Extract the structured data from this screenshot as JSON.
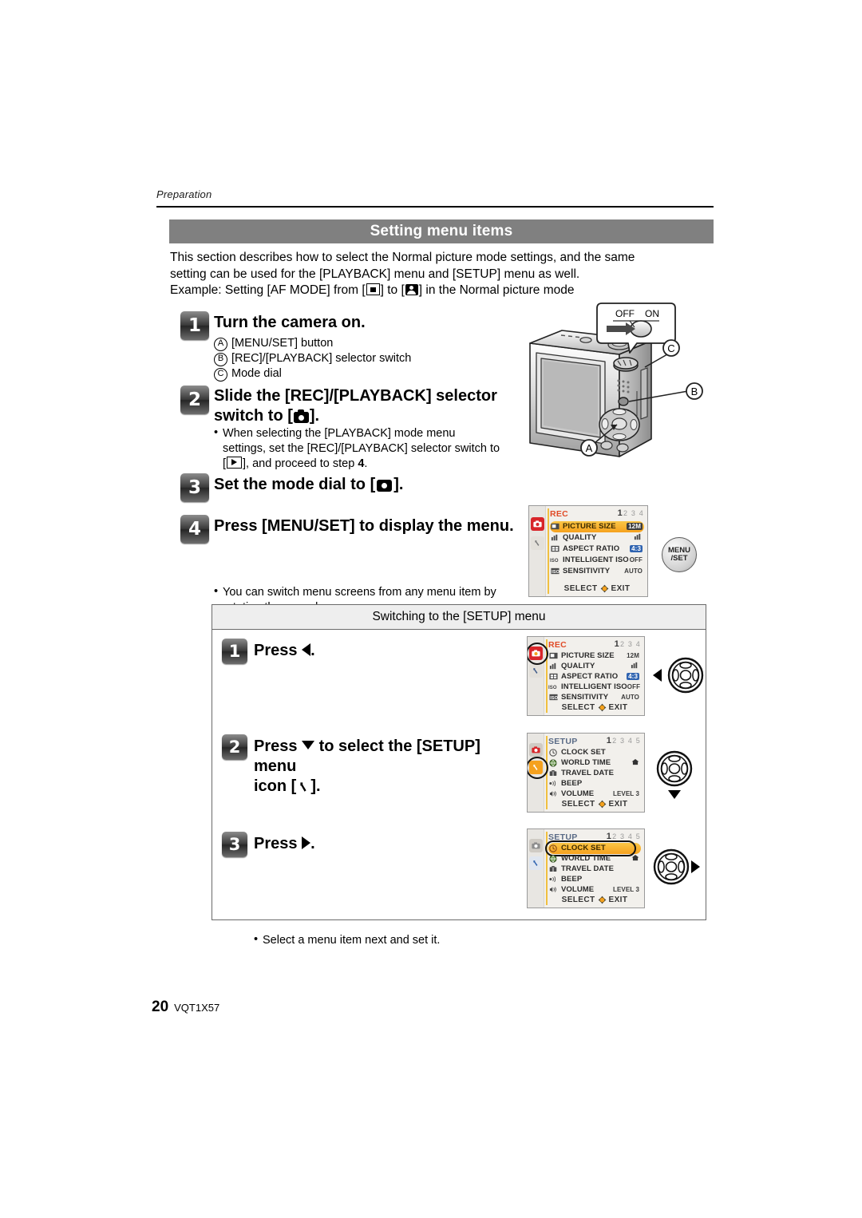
{
  "running_head": "Preparation",
  "section_title": "Setting menu items",
  "intro": {
    "line1": "This section describes how to select the Normal picture mode settings, and the same",
    "line2": "setting can be used for the [PLAYBACK] menu and [SETUP] menu as well.",
    "line3_prefix": "Example: Setting [AF MODE] from [",
    "line3_mid": "] to [",
    "line3_suffix": "] in the Normal picture mode"
  },
  "steps": [
    {
      "num": "1",
      "title": "Turn the camera on.",
      "callouts": [
        {
          "letter": "A",
          "text": "[MENU/SET] button"
        },
        {
          "letter": "B",
          "text": "[REC]/[PLAYBACK] selector switch"
        },
        {
          "letter": "C",
          "text": "Mode dial"
        }
      ]
    },
    {
      "num": "2",
      "title_line1": "Slide the [REC]/[PLAYBACK] selector",
      "title_line2_prefix": "switch to [",
      "title_line2_suffix": "].",
      "bullet_line1": "When selecting the [PLAYBACK] mode menu",
      "bullet_line2": "settings, set the [REC]/[PLAYBACK] selector switch to",
      "bullet_line3_prefix": "[",
      "bullet_line3_suffix": "], and proceed to step ",
      "bullet_line3_step": "4",
      "bullet_line3_end": "."
    },
    {
      "num": "3",
      "title_prefix": "Set the mode dial to [",
      "title_suffix": "]."
    },
    {
      "num": "4",
      "title": "Press [MENU/SET] to display the menu.",
      "bullet_line1": "You can switch menu screens from any menu item by",
      "bullet_line2": "rotating the zoom lever."
    }
  ],
  "camera": {
    "switch_off_label": "OFF",
    "switch_on_label": "ON",
    "label_a": "A",
    "label_b": "B",
    "label_c": "C"
  },
  "menuset_button": {
    "line1": "MENU",
    "line2": "/SET"
  },
  "switching_box": {
    "header": "Switching to the [SETUP] menu",
    "steps": [
      {
        "num": "1",
        "title_prefix": "Press ",
        "title_arrow": "left-arrow",
        "title_suffix": "."
      },
      {
        "num": "2",
        "title_line1_prefix": "Press ",
        "title_line1_arrow": "down-arrow",
        "title_line1_suffix": " to select the [SETUP] menu",
        "title_line2_prefix": "icon [",
        "title_line2_suffix": "]."
      },
      {
        "num": "3",
        "title_prefix": "Press ",
        "title_arrow": "right-arrow",
        "title_suffix": ".",
        "bullet": "Select a menu item next and set it."
      }
    ]
  },
  "lcd_screens": [
    {
      "id": "rec-menu-step4",
      "title": "REC",
      "pages": {
        "current": "1",
        "rest": "2 3 4"
      },
      "active_tab": "rec",
      "rows": [
        {
          "icon": "picture-size-icon",
          "label": "PICTURE SIZE",
          "value": "12M",
          "value_style": "box",
          "highlighted": true
        },
        {
          "icon": "quality-icon",
          "label": "QUALITY",
          "value": "",
          "value_style": "glyph",
          "highlighted": false
        },
        {
          "icon": "aspect-ratio-icon",
          "label": "ASPECT RATIO",
          "value": "4:3",
          "value_style": "blue",
          "highlighted": false
        },
        {
          "icon": "intelligent-iso-icon",
          "label": "INTELLIGENT ISO",
          "value": "OFF",
          "value_style": "plain",
          "highlighted": false
        },
        {
          "icon": "sensitivity-icon",
          "label": "SENSITIVITY",
          "value": "AUTO",
          "value_style": "plain",
          "highlighted": false
        }
      ],
      "footer": {
        "select": "SELECT",
        "exit": "EXIT"
      },
      "mark": "none"
    },
    {
      "id": "rec-menu-sub1",
      "title": "REC",
      "pages": {
        "current": "1",
        "rest": "2 3 4"
      },
      "active_tab": "rec",
      "rows": [
        {
          "icon": "picture-size-icon",
          "label": "PICTURE SIZE",
          "value": "12M",
          "value_style": "plain",
          "highlighted": false
        },
        {
          "icon": "quality-icon",
          "label": "QUALITY",
          "value": "",
          "value_style": "glyph",
          "highlighted": false
        },
        {
          "icon": "aspect-ratio-icon",
          "label": "ASPECT RATIO",
          "value": "4:3",
          "value_style": "blue",
          "highlighted": false
        },
        {
          "icon": "intelligent-iso-icon",
          "label": "INTELLIGENT ISO",
          "value": "OFF",
          "value_style": "plain",
          "highlighted": false
        },
        {
          "icon": "sensitivity-icon",
          "label": "SENSITIVITY",
          "value": "AUTO",
          "value_style": "plain",
          "highlighted": false
        }
      ],
      "footer": {
        "select": "SELECT",
        "exit": "EXIT"
      },
      "mark": "tab-rec"
    },
    {
      "id": "setup-menu-sub2",
      "title": "SETUP",
      "pages": {
        "current": "1",
        "rest": "2 3 4 5"
      },
      "active_tab": "setup",
      "rows": [
        {
          "icon": "clock-set-icon",
          "label": "CLOCK SET",
          "value": "",
          "value_style": "plain",
          "highlighted": false
        },
        {
          "icon": "world-time-icon",
          "label": "WORLD TIME",
          "value": "",
          "value_style": "home",
          "highlighted": false
        },
        {
          "icon": "travel-date-icon",
          "label": "TRAVEL DATE",
          "value": "",
          "value_style": "plain",
          "highlighted": false
        },
        {
          "icon": "beep-icon",
          "label": "BEEP",
          "value": "",
          "value_style": "plain",
          "highlighted": false
        },
        {
          "icon": "volume-icon",
          "label": "VOLUME",
          "value": "LEVEL 3",
          "value_style": "level",
          "highlighted": false
        }
      ],
      "footer": {
        "select": "SELECT",
        "exit": "EXIT"
      },
      "mark": "tab-setup"
    },
    {
      "id": "setup-menu-sub3",
      "title": "SETUP",
      "pages": {
        "current": "1",
        "rest": "2 3 4 5"
      },
      "active_tab": "setup",
      "rows": [
        {
          "icon": "clock-set-icon",
          "label": "CLOCK SET",
          "value": "",
          "value_style": "plain",
          "highlighted": true
        },
        {
          "icon": "world-time-icon",
          "label": "WORLD TIME",
          "value": "",
          "value_style": "home",
          "highlighted": false
        },
        {
          "icon": "travel-date-icon",
          "label": "TRAVEL DATE",
          "value": "",
          "value_style": "plain",
          "highlighted": false
        },
        {
          "icon": "beep-icon",
          "label": "BEEP",
          "value": "",
          "value_style": "plain",
          "highlighted": false
        },
        {
          "icon": "volume-icon",
          "label": "VOLUME",
          "value": "LEVEL 3",
          "value_style": "level",
          "highlighted": false
        }
      ],
      "footer": {
        "select": "SELECT",
        "exit": "EXIT"
      },
      "mark": "row-clock-set"
    }
  ],
  "footer": {
    "page_number": "20",
    "doc_code": "VQT1X57"
  },
  "colors": {
    "section_bar": "#808080",
    "highlight_orange": "#f5a11e",
    "rec_red": "#d8252a",
    "rec_title": "#e04a26",
    "setup_title": "#5a6b86"
  }
}
